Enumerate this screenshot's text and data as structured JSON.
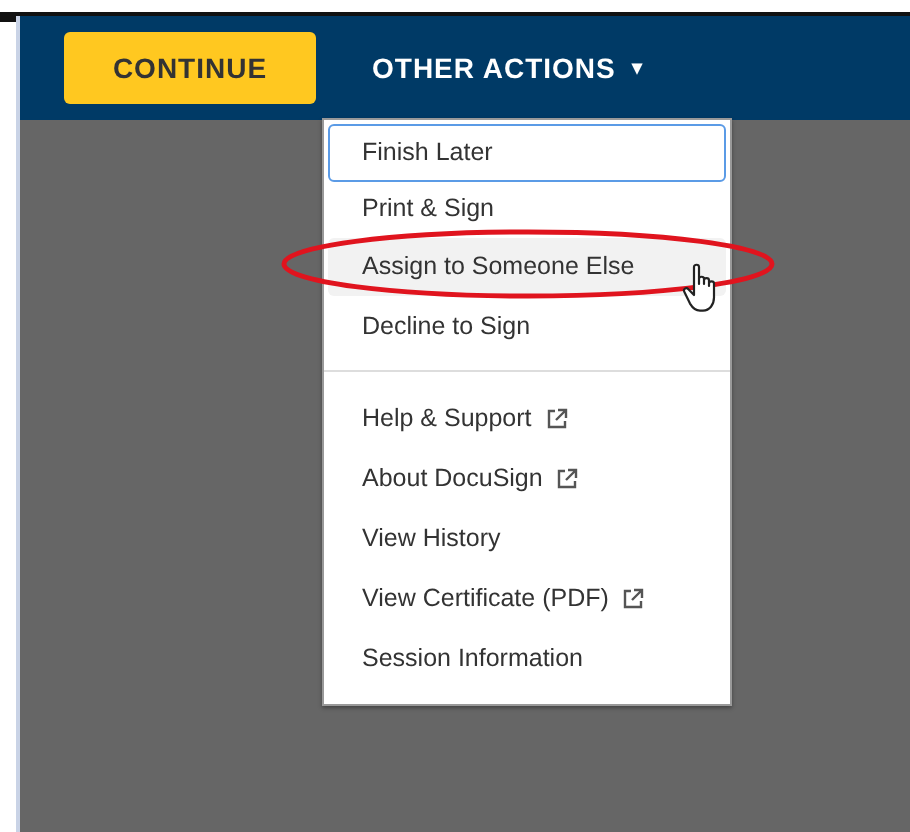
{
  "toolbar": {
    "continue_button": "CONTINUE",
    "other_actions": {
      "label": "OTHER ACTIONS",
      "caret": "▾"
    }
  },
  "menu": {
    "sections": [
      [
        {
          "label": "Finish Later",
          "focused": true,
          "hovered": false,
          "external": false
        },
        {
          "label": "Print & Sign",
          "focused": false,
          "hovered": false,
          "external": false
        },
        {
          "label": "Assign to Someone Else",
          "focused": false,
          "hovered": true,
          "external": false
        },
        {
          "label": "Decline to Sign",
          "focused": false,
          "hovered": false,
          "external": false
        }
      ],
      [
        {
          "label": "Help & Support",
          "focused": false,
          "hovered": false,
          "external": true
        },
        {
          "label": "About DocuSign",
          "focused": false,
          "hovered": false,
          "external": true
        },
        {
          "label": "View History",
          "focused": false,
          "hovered": false,
          "external": false
        },
        {
          "label": "View Certificate (PDF)",
          "focused": false,
          "hovered": false,
          "external": true
        },
        {
          "label": "Session Information",
          "focused": false,
          "hovered": false,
          "external": false
        }
      ]
    ]
  }
}
